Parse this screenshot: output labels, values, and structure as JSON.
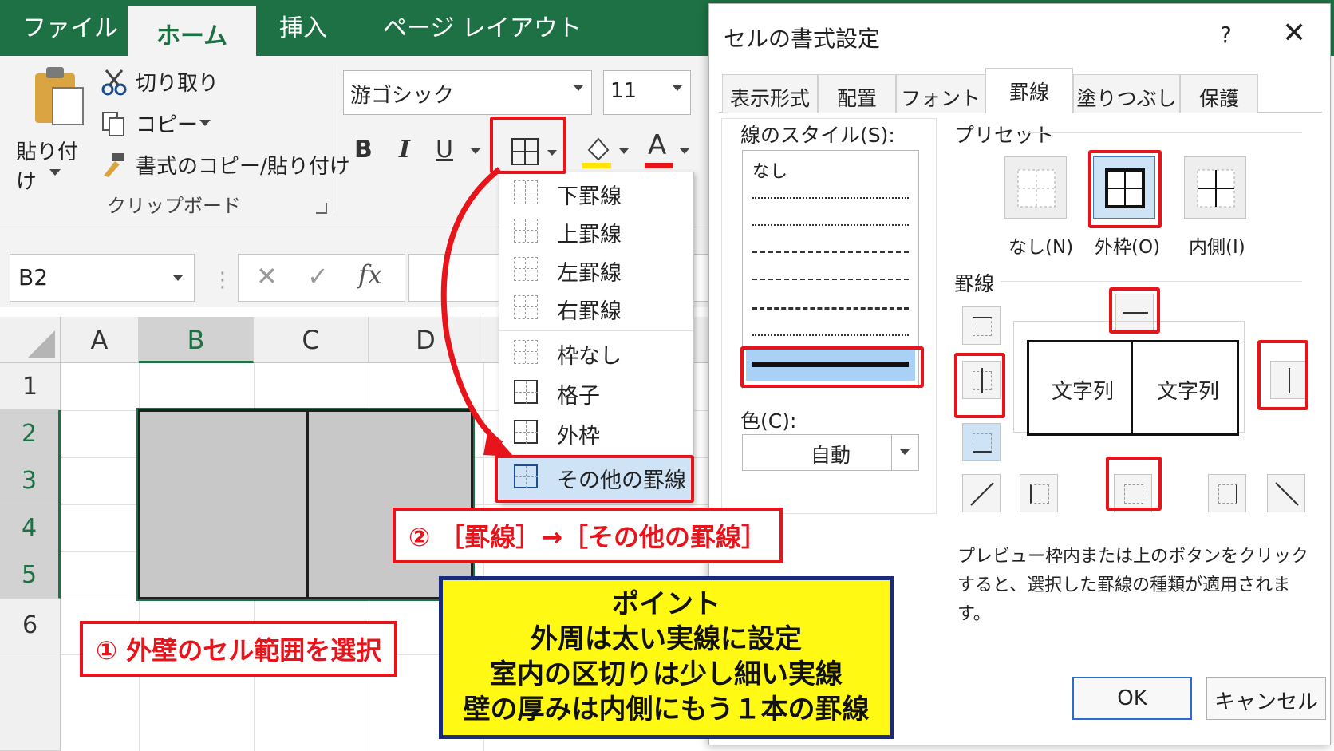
{
  "ribbon": {
    "tabs": [
      "ファイル",
      "ホーム",
      "挿入",
      "ページ レイアウト"
    ],
    "paste": "貼り付け",
    "cut": "切り取り",
    "copy": "コピー",
    "format_painter": "書式のコピー/貼り付け",
    "clipboard_group": "クリップボード",
    "font_name": "游ゴシック",
    "font_size": "11",
    "bold": "B",
    "italic": "I",
    "underline": "U",
    "font_color_letter": "A"
  },
  "formula_bar": {
    "name_box": "B2",
    "cancel": "✕",
    "enter": "✓",
    "fx": "fx"
  },
  "grid": {
    "columns": [
      "A",
      "B",
      "C",
      "D"
    ],
    "rows": [
      "1",
      "2",
      "3",
      "4",
      "5",
      "6"
    ]
  },
  "border_menu": {
    "items": [
      "下罫線",
      "上罫線",
      "左罫線",
      "右罫線",
      "枠なし",
      "格子",
      "外枠",
      "その他の罫線"
    ]
  },
  "annotations": {
    "step1": "① 外壁のセル範囲を選択",
    "step2": "② ［罫線］→［その他の罫線］",
    "note_lines": [
      "ポイント",
      "外周は太い実線に設定",
      "室内の区切りは少し細い実線",
      "壁の厚みは内側にもう１本の罫線"
    ]
  },
  "dialog": {
    "title": "セルの書式設定",
    "help": "?",
    "close": "✕",
    "tabs": [
      "表示形式",
      "配置",
      "フォント",
      "罫線",
      "塗りつぶし",
      "保護"
    ],
    "line_style_label": "線のスタイル(S):",
    "none_style": "なし",
    "color_label": "色(C):",
    "color_value": "自動",
    "preset_label": "プリセット",
    "preset_none": "なし(N)",
    "preset_outline": "外枠(O)",
    "preset_inside": "内側(I)",
    "border_label": "罫線",
    "preview_text": [
      "文字列",
      "文字列"
    ],
    "hint": "プレビュー枠内または上のボタンをクリックすると、選択した罫線の種類が適用されます。",
    "ok": "OK",
    "cancel": "キャンセル"
  },
  "colors": {
    "excel_green": "#1e7145",
    "annotation_red": "#e8141b",
    "note_yellow": "#fff914",
    "note_border": "#1a2a7a"
  }
}
